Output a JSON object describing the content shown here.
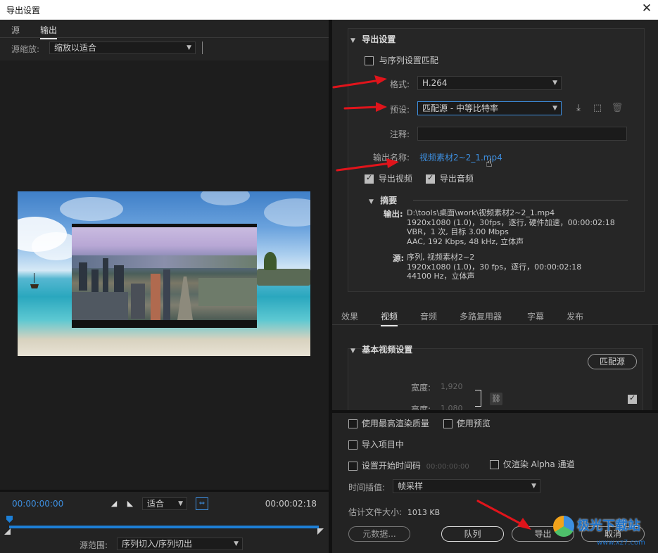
{
  "window": {
    "title": "导出设置",
    "close": "✕"
  },
  "left": {
    "tabs": [
      "源",
      "输出"
    ],
    "source_scale_label": "源缩放:",
    "source_scale_value": "缩放以适合",
    "timecode_start": "00:00:00:00",
    "timecode_end": "00:00:02:18",
    "fit_value": "适合",
    "source_range_label": "源范围:",
    "source_range_value": "序列切入/序列切出"
  },
  "export_settings": {
    "section_title": "导出设置",
    "match_sequence_label": "与序列设置匹配",
    "format_label": "格式:",
    "format_value": "H.264",
    "preset_label": "预设:",
    "preset_value": "匹配源 - 中等比特率",
    "comment_label": "注释:",
    "comment_value": "",
    "output_name_label": "输出名称:",
    "output_name_value": "视频素材2~2_1.mp4",
    "export_video_label": "导出视频",
    "export_audio_label": "导出音频",
    "export_video_checked": true,
    "export_audio_checked": true,
    "summary_title": "摘要",
    "output_key": "输出:",
    "output_lines": [
      "D:\\tools\\桌面\\work\\视频素材2~2_1.mp4",
      "1920x1080 (1.0)，30fps，逐行, 硬件加速，00:00:02:18",
      "VBR，1 次, 目标 3.00 Mbps",
      "AAC, 192 Kbps, 48  kHz, 立体声"
    ],
    "source_key": "源:",
    "source_lines": [
      "序列, 视频素材2~2",
      "1920x1080 (1.0)，30 fps，逐行，00:00:02:18",
      "44100 Hz，立体声"
    ]
  },
  "right_tabs": [
    "效果",
    "视频",
    "音频",
    "多路复用器",
    "字幕",
    "发布"
  ],
  "basic_video": {
    "section_title": "基本视频设置",
    "match_source_button": "匹配源",
    "width_label": "宽度:",
    "width_value": "1,920",
    "height_label": "高度:",
    "height_value": "1,080"
  },
  "bottom": {
    "max_render_quality": "使用最高渲染质量",
    "use_previews": "使用预览",
    "import_into_project": "导入项目中",
    "set_start_timecode": "设置开始时间码",
    "start_timecode_value": "00:00:00:00",
    "render_alpha_only": "仅渲染 Alpha 通道",
    "time_interpolation_label": "时间插值:",
    "time_interpolation_value": "帧采样",
    "estimated_size_label": "估计文件大小:",
    "estimated_size_value": "1013 KB",
    "metadata_button": "元数据...",
    "queue_button": "队列",
    "export_button": "导出",
    "cancel_button": "取消"
  },
  "watermark": {
    "brand": "极光下载站",
    "url": "www.xz7.com"
  },
  "colors": {
    "accent_blue": "#3d8fe0",
    "arrow_red": "#e0141b",
    "panel_bg": "#232323"
  }
}
